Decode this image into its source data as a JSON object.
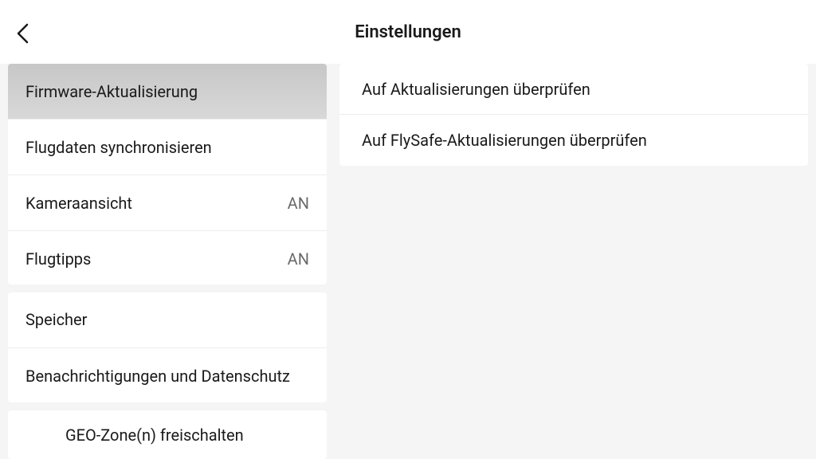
{
  "header": {
    "title": "Einstellungen"
  },
  "sidebar": {
    "groups": [
      {
        "items": [
          {
            "label": "Firmware-Aktualisierung",
            "value": "",
            "selected": true
          },
          {
            "label": "Flugdaten synchronisieren",
            "value": ""
          },
          {
            "label": "Kameraansicht",
            "value": "AN"
          },
          {
            "label": "Flugtipps",
            "value": "AN"
          }
        ]
      },
      {
        "items": [
          {
            "label": "Speicher",
            "value": ""
          },
          {
            "label": "Benachrichtigungen und Datenschutz",
            "value": ""
          }
        ]
      },
      {
        "items": [
          {
            "label": "GEO-Zone(n) freischalten",
            "value": "",
            "indented": true
          }
        ]
      }
    ]
  },
  "detail": {
    "items": [
      {
        "label": "Auf Aktualisierungen überprüfen"
      },
      {
        "label": "Auf FlySafe-Aktualisierungen überprüfen"
      }
    ]
  }
}
